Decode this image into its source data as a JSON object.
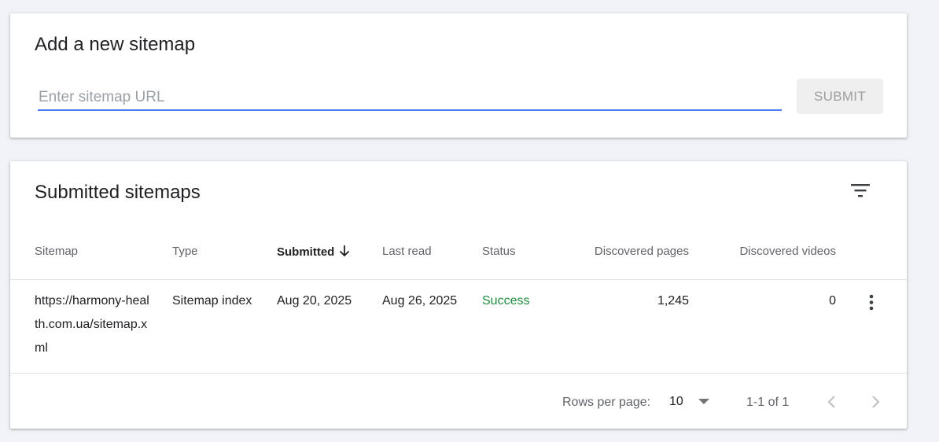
{
  "add_sitemap": {
    "title": "Add a new sitemap",
    "input_placeholder": "Enter sitemap URL",
    "input_value": "",
    "submit_label": "SUBMIT"
  },
  "submitted": {
    "title": "Submitted sitemaps",
    "filter_icon": "filter-icon",
    "columns": {
      "sitemap": "Sitemap",
      "type": "Type",
      "submitted": "Submitted",
      "last_read": "Last read",
      "status": "Status",
      "discovered_pages": "Discovered pages",
      "discovered_videos": "Discovered videos"
    },
    "sort_column": "submitted",
    "sort_direction": "descending",
    "rows": [
      {
        "sitemap": "https://harmony-health.com.ua/sitemap.xml",
        "type": "Sitemap index",
        "submitted": "Aug 20, 2025",
        "last_read": "Aug 26, 2025",
        "status": "Success",
        "discovered_pages": "1,245",
        "discovered_videos": "0"
      }
    ],
    "footer": {
      "rows_per_page_label": "Rows per page:",
      "rows_per_page_value": "10",
      "range": "1-1 of 1"
    }
  },
  "colors": {
    "accent": "#4a80f5",
    "success": "#1e8e3e",
    "background": "#f1f3f8"
  }
}
